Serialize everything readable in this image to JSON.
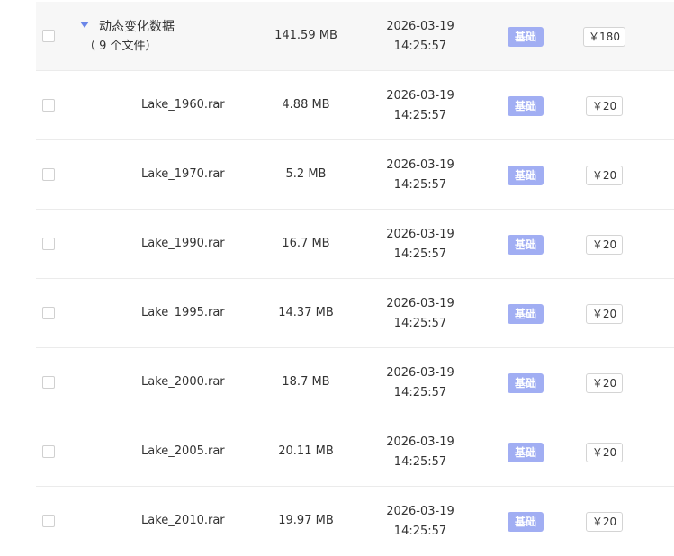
{
  "group": {
    "name": "动态变化数据",
    "count_text": "（ 9 个文件）",
    "size": "141.59 MB",
    "date": "2026-03-19",
    "time": "14:25:57",
    "tier": "基础",
    "price": "￥180"
  },
  "files": [
    {
      "name": "Lake_1960.rar",
      "size": "4.88 MB",
      "date": "2026-03-19",
      "time": "14:25:57",
      "tier": "基础",
      "price": "￥20"
    },
    {
      "name": "Lake_1970.rar",
      "size": "5.2 MB",
      "date": "2026-03-19",
      "time": "14:25:57",
      "tier": "基础",
      "price": "￥20"
    },
    {
      "name": "Lake_1990.rar",
      "size": "16.7 MB",
      "date": "2026-03-19",
      "time": "14:25:57",
      "tier": "基础",
      "price": "￥20"
    },
    {
      "name": "Lake_1995.rar",
      "size": "14.37 MB",
      "date": "2026-03-19",
      "time": "14:25:57",
      "tier": "基础",
      "price": "￥20"
    },
    {
      "name": "Lake_2000.rar",
      "size": "18.7 MB",
      "date": "2026-03-19",
      "time": "14:25:57",
      "tier": "基础",
      "price": "￥20"
    },
    {
      "name": "Lake_2005.rar",
      "size": "20.11 MB",
      "date": "2026-03-19",
      "time": "14:25:57",
      "tier": "基础",
      "price": "￥20"
    },
    {
      "name": "Lake_2010.rar",
      "size": "19.97 MB",
      "date": "2026-03-19",
      "time": "14:25:57",
      "tier": "基础",
      "price": "￥20"
    }
  ],
  "colors": {
    "badge": "#a1aef3",
    "caret": "#6b86e8",
    "group_background": "#f7f7f7"
  },
  "icons": {
    "expand": "caret-down-icon"
  }
}
